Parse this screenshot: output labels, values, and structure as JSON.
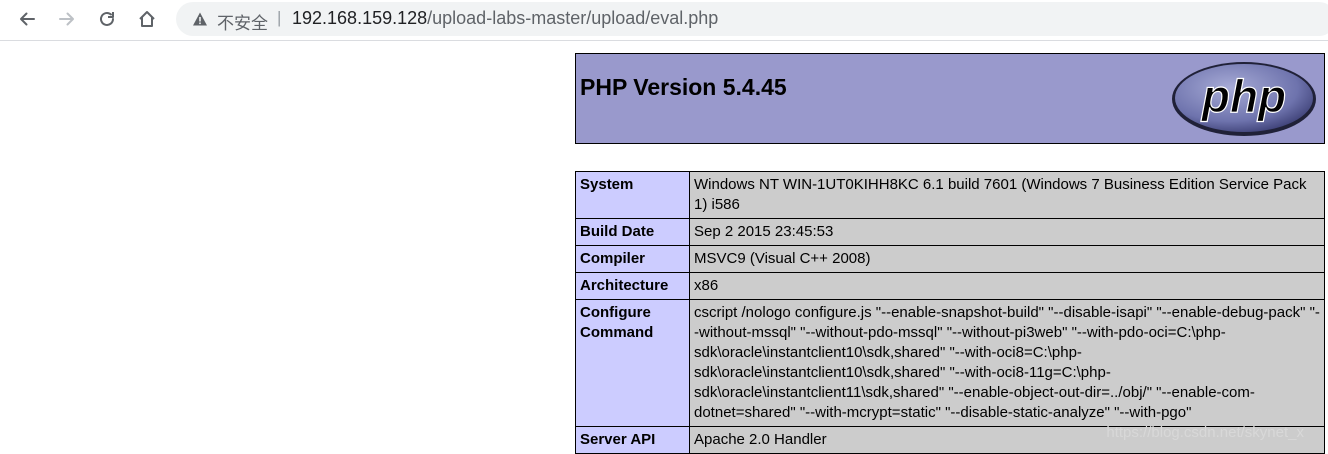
{
  "browser": {
    "security_label": "不安全",
    "separator": "|",
    "url_host": "192.168.159.128",
    "url_path": "/upload-labs-master/upload/eval.php"
  },
  "page": {
    "title": "PHP Version 5.4.45",
    "logo_text": "php"
  },
  "info_rows": [
    {
      "key": "System",
      "value": "Windows NT WIN-1UT0KIHH8KC 6.1 build 7601 (Windows 7 Business Edition Service Pack 1) i586"
    },
    {
      "key": "Build Date",
      "value": "Sep 2 2015 23:45:53"
    },
    {
      "key": "Compiler",
      "value": "MSVC9 (Visual C++ 2008)"
    },
    {
      "key": "Architecture",
      "value": "x86"
    },
    {
      "key": "Configure Command",
      "value": "cscript /nologo configure.js \"--enable-snapshot-build\" \"--disable-isapi\" \"--enable-debug-pack\" \"--without-mssql\" \"--without-pdo-mssql\" \"--without-pi3web\" \"--with-pdo-oci=C:\\php-sdk\\oracle\\instantclient10\\sdk,shared\" \"--with-oci8=C:\\php-sdk\\oracle\\instantclient10\\sdk,shared\" \"--with-oci8-11g=C:\\php-sdk\\oracle\\instantclient11\\sdk,shared\" \"--enable-object-out-dir=../obj/\" \"--enable-com-dotnet=shared\" \"--with-mcrypt=static\" \"--disable-static-analyze\" \"--with-pgo\""
    },
    {
      "key": "Server API",
      "value": "Apache 2.0 Handler"
    }
  ],
  "watermark": "https://blog.csdn.net/skynet_x",
  "colors": {
    "header_bg": "#9999cc",
    "key_bg": "#ccccff",
    "value_bg": "#cccccc"
  }
}
